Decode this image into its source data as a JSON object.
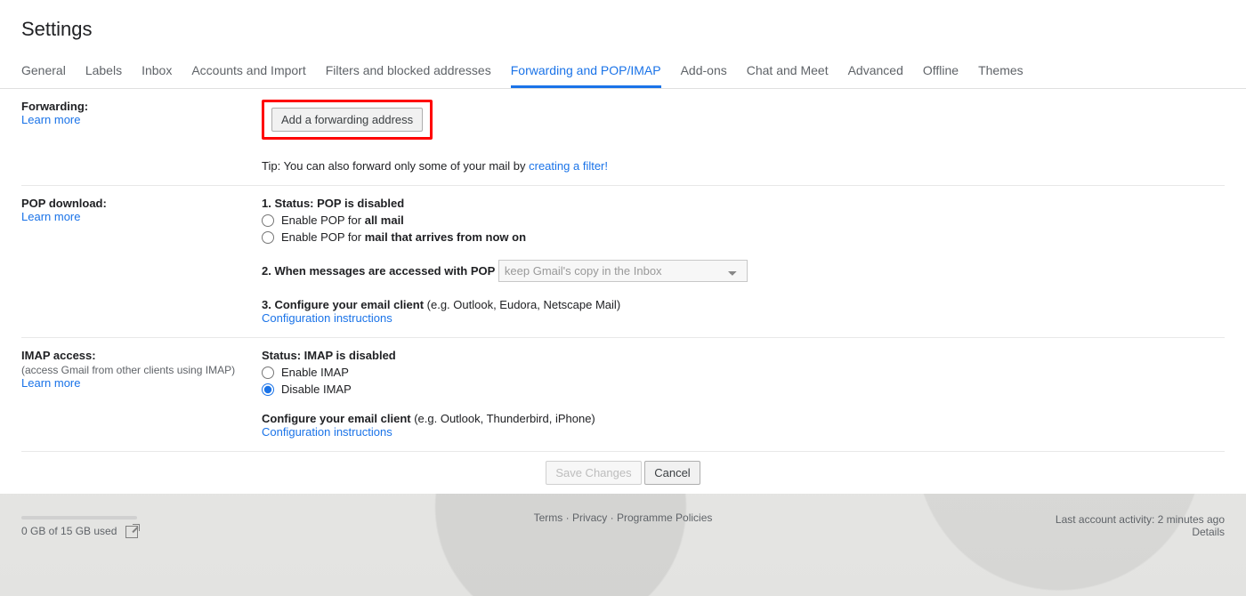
{
  "page_title": "Settings",
  "tabs": [
    {
      "label": "General"
    },
    {
      "label": "Labels"
    },
    {
      "label": "Inbox"
    },
    {
      "label": "Accounts and Import"
    },
    {
      "label": "Filters and blocked addresses"
    },
    {
      "label": "Forwarding and POP/IMAP",
      "active": true
    },
    {
      "label": "Add-ons"
    },
    {
      "label": "Chat and Meet"
    },
    {
      "label": "Advanced"
    },
    {
      "label": "Offline"
    },
    {
      "label": "Themes"
    }
  ],
  "forwarding": {
    "title": "Forwarding:",
    "learn_more": "Learn more",
    "button": "Add a forwarding address",
    "tip_prefix": "Tip: You can also forward only some of your mail by ",
    "tip_link": "creating a filter!"
  },
  "pop": {
    "title": "POP download:",
    "learn_more": "Learn more",
    "status_prefix": "1. Status: ",
    "status_value": "POP is disabled",
    "opt1_prefix": "Enable POP for ",
    "opt1_bold": "all mail",
    "opt2_prefix": "Enable POP for ",
    "opt2_bold": "mail that arrives from now on",
    "step2": "2. When messages are accessed with POP",
    "select_value": "keep Gmail's copy in the Inbox",
    "step3_bold": "3. Configure your email client ",
    "step3_rest": "(e.g. Outlook, Eudora, Netscape Mail)",
    "config_link": "Configuration instructions"
  },
  "imap": {
    "title": "IMAP access:",
    "sub": "(access Gmail from other clients using IMAP)",
    "learn_more": "Learn more",
    "status_prefix": "Status: ",
    "status_value": "IMAP is disabled",
    "opt_enable": "Enable IMAP",
    "opt_disable": "Disable IMAP",
    "conf_bold": "Configure your email client ",
    "conf_rest": "(e.g. Outlook, Thunderbird, iPhone)",
    "config_link": "Configuration instructions"
  },
  "actions": {
    "save": "Save Changes",
    "cancel": "Cancel"
  },
  "footer": {
    "storage": "0 GB of 15 GB used",
    "terms": "Terms",
    "privacy": "Privacy",
    "policies": "Programme Policies",
    "activity": "Last account activity: 2 minutes ago",
    "details": "Details"
  }
}
